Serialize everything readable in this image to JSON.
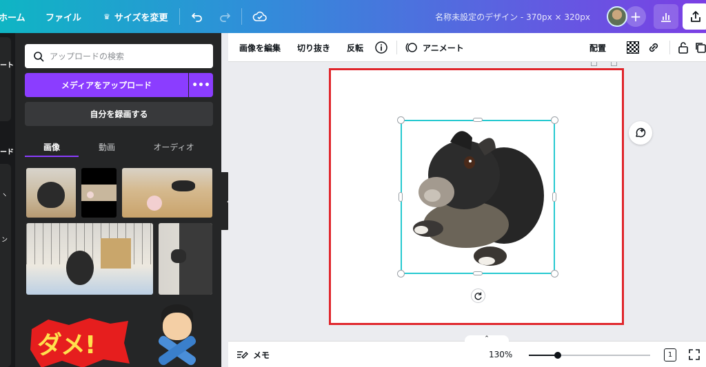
{
  "topbar": {
    "home": "ホーム",
    "file": "ファイル",
    "resize": "サイズを変更",
    "title": "名称未設定のデザイン - 370px × 320px"
  },
  "rail": {
    "label_1": "ート",
    "label_2": "ード"
  },
  "panel": {
    "search_placeholder": "アップロードの検索",
    "upload_button": "メディアをアップロード",
    "record_button": "自分を録画する",
    "tabs": [
      "画像",
      "動画",
      "オーディオ"
    ],
    "sticker_text": "ダメ!"
  },
  "toolbar": {
    "edit_image": "画像を編集",
    "crop": "切り抜き",
    "flip": "反転",
    "animate": "アニメート",
    "position": "配置"
  },
  "bottombar": {
    "notes": "メモ",
    "zoom": "130%",
    "zoom_fraction": 0.24,
    "page_number": "1"
  }
}
